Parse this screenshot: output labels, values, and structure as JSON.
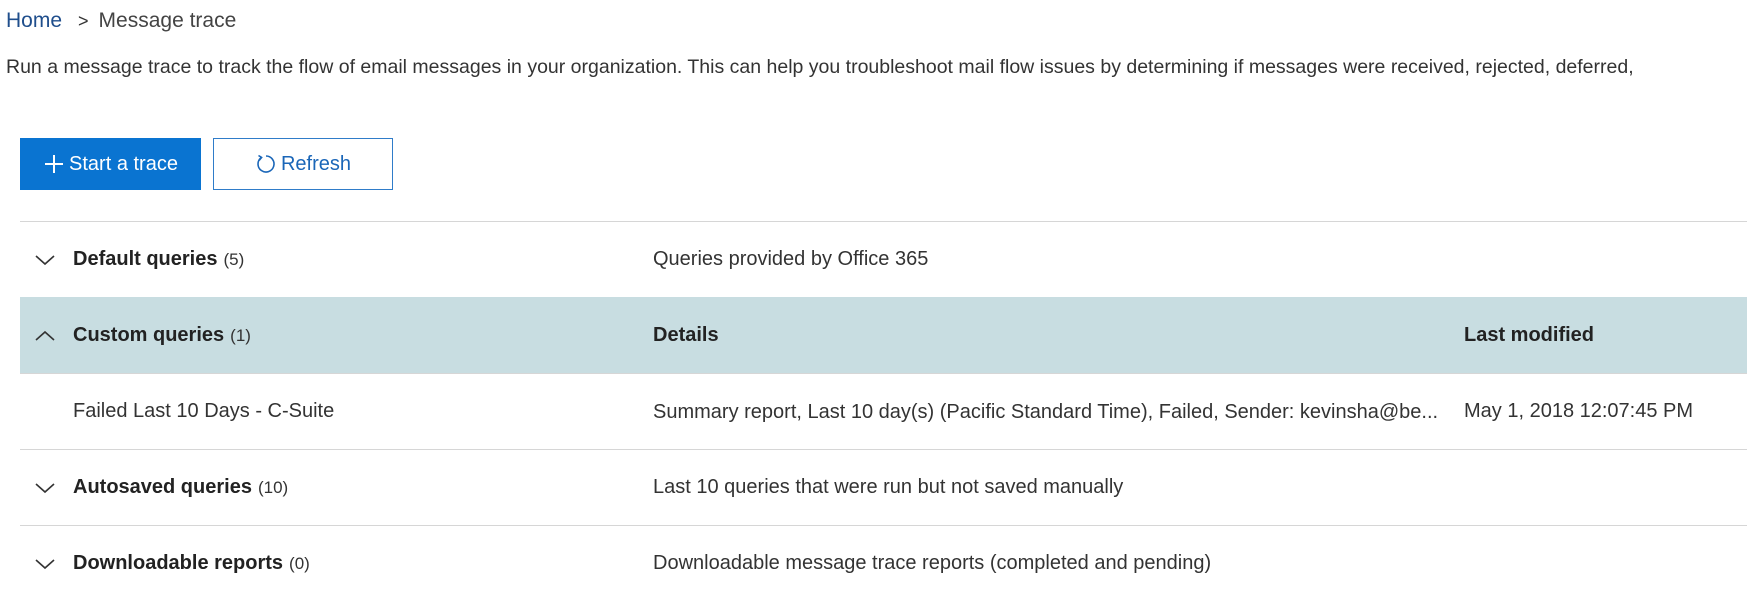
{
  "breadcrumb": {
    "home": "Home",
    "separator": ">",
    "current": "Message trace"
  },
  "description": "Run a message trace to track the flow of email messages in your organization. This can help you troubleshoot mail flow issues by determining if messages were received, rejected, deferred,",
  "toolbar": {
    "start_label": "Start a trace",
    "start_icon": "plus-icon",
    "refresh_label": "Refresh",
    "refresh_icon": "refresh-icon"
  },
  "groups": {
    "default": {
      "title": "Default queries",
      "count": "(5)",
      "details": "Queries provided by Office 365",
      "expanded": false
    },
    "custom": {
      "title": "Custom queries",
      "count": "(1)",
      "details_header": "Details",
      "modified_header": "Last modified",
      "expanded": true,
      "items": [
        {
          "name": "Failed Last 10 Days - C-Suite",
          "details": "Summary report, Last 10 day(s) (Pacific Standard Time), Failed, Sender: kevinsha@be...",
          "modified": "May 1, 2018 12:07:45 PM"
        }
      ]
    },
    "autosaved": {
      "title": "Autosaved queries",
      "count": "(10)",
      "details": "Last 10 queries that were run but not saved manually",
      "expanded": false
    },
    "downloadable": {
      "title": "Downloadable reports",
      "count": "(0)",
      "details": "Downloadable message trace reports (completed and pending)",
      "expanded": false
    }
  },
  "colors": {
    "primary": "#0a74d1",
    "selected_row": "#c8dde1",
    "link": "#1f4e8c"
  }
}
